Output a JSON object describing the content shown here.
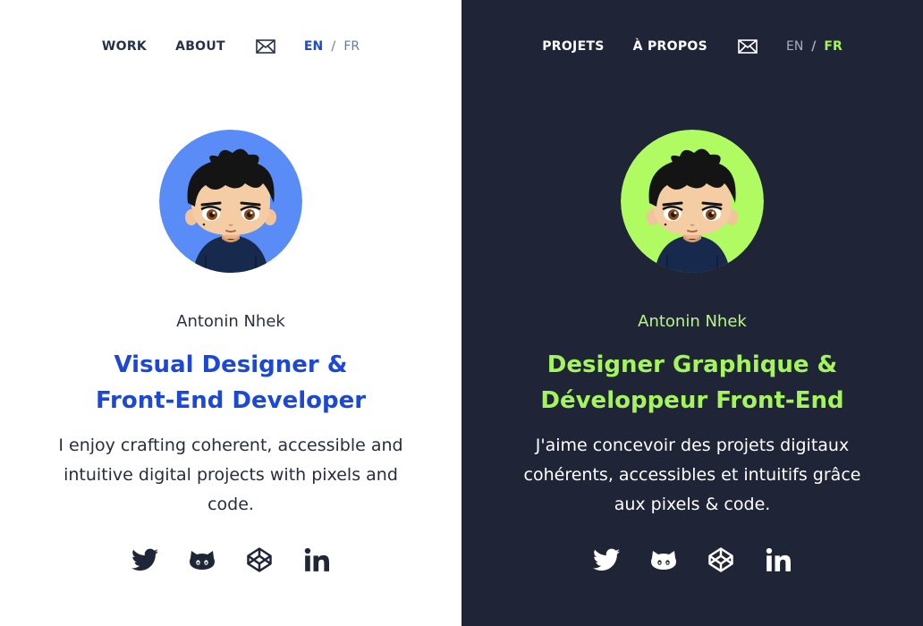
{
  "colors": {
    "light_bg": "#ffffff",
    "dark_bg": "#1f2436",
    "light_accent": "#1b48d6",
    "dark_accent": "#a4f55b",
    "light_avatar_bg": "#5a8cf8",
    "dark_avatar_bg": "#b0fb62"
  },
  "en": {
    "nav": {
      "work": "WORK",
      "about": "ABOUT",
      "mail_icon": "mail-icon"
    },
    "lang": {
      "en": "EN",
      "sep": "/",
      "fr": "FR",
      "active": "EN"
    },
    "name": "Antonin Nhek",
    "title_lines": [
      "Visual Designer &",
      "Front-End Developer"
    ],
    "desc_lines": [
      "I enjoy crafting coherent, accessible and",
      "intuitive digital projects with pixels and",
      "code."
    ],
    "social": [
      "twitter-icon",
      "github-icon",
      "codepen-icon",
      "linkedin-icon"
    ]
  },
  "fr": {
    "nav": {
      "work": "PROJETS",
      "about": "À PROPOS",
      "mail_icon": "mail-icon"
    },
    "lang": {
      "en": "EN",
      "sep": "/",
      "fr": "FR",
      "active": "FR"
    },
    "name": "Antonin Nhek",
    "title_lines": [
      "Designer Graphique &",
      "Développeur Front-End"
    ],
    "desc_lines": [
      "J'aime concevoir des projets digitaux",
      "cohérents, accessibles et intuitifs grâce",
      "aux pixels & code."
    ],
    "social": [
      "twitter-icon",
      "github-icon",
      "codepen-icon",
      "linkedin-icon"
    ]
  }
}
